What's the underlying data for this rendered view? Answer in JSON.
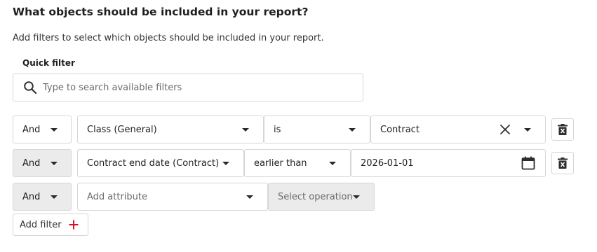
{
  "header": {
    "title": "What objects should be included in your report?",
    "description": "Add filters to select which objects should be included in your report."
  },
  "quick_filter": {
    "label": "Quick filter",
    "placeholder": "Type to search available filters",
    "icon": "search-icon"
  },
  "filters": [
    {
      "connector": "And",
      "attribute": "Class (General)",
      "operation": "is",
      "value": "Contract",
      "value_icons": [
        "close-icon",
        "chevron-down-icon"
      ],
      "delete_icon": "trash-icon"
    },
    {
      "connector": "And",
      "attribute": "Contract end date (Contract)",
      "operation": "earlier than",
      "value": "2026-01-01",
      "value_icons": [
        "calendar-icon"
      ],
      "delete_icon": "trash-icon"
    },
    {
      "connector": "And",
      "attribute_placeholder": "Add attribute",
      "operation_placeholder": "Select operation"
    }
  ],
  "add_filter": {
    "label": "Add filter",
    "icon": "plus-icon",
    "icon_color": "#d4121f"
  }
}
